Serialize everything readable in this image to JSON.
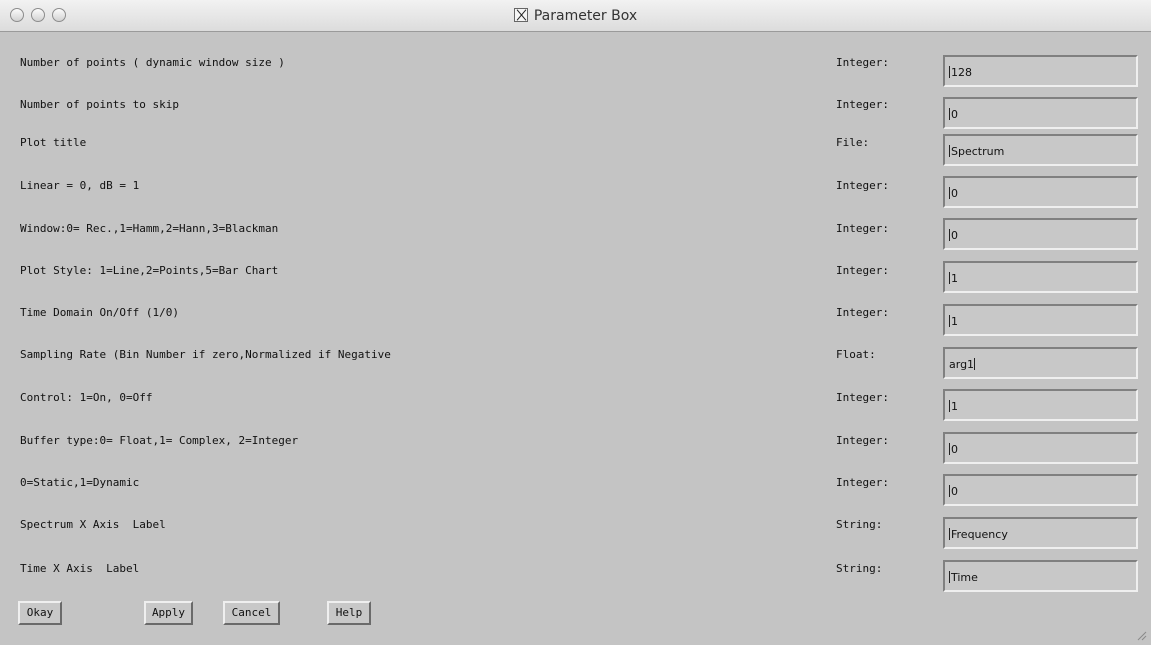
{
  "window": {
    "title": "Parameter Box"
  },
  "params": [
    {
      "label": "Number of points ( dynamic window size )",
      "type": "Integer:",
      "value": "128"
    },
    {
      "label": "Number of points to skip",
      "type": "Integer:",
      "value": "0"
    },
    {
      "label": "Plot title",
      "type": "File:",
      "value": "Spectrum"
    },
    {
      "label": "Linear = 0, dB = 1",
      "type": "Integer:",
      "value": "0"
    },
    {
      "label": "Window:0= Rec.,1=Hamm,2=Hann,3=Blackman",
      "type": "Integer:",
      "value": "0"
    },
    {
      "label": "Plot Style: 1=Line,2=Points,5=Bar Chart",
      "type": "Integer:",
      "value": "1"
    },
    {
      "label": "Time Domain On/Off (1/0)",
      "type": "Integer:",
      "value": "1"
    },
    {
      "label": "Sampling Rate (Bin Number if zero,Normalized if Negative",
      "type": "Float:",
      "value": "arg1"
    },
    {
      "label": "Control: 1=On, 0=Off",
      "type": "Integer:",
      "value": "1"
    },
    {
      "label": "Buffer type:0= Float,1= Complex, 2=Integer",
      "type": "Integer:",
      "value": "0"
    },
    {
      "label": "0=Static,1=Dynamic",
      "type": "Integer:",
      "value": "0"
    },
    {
      "label": "Spectrum X Axis  Label",
      "type": "String:",
      "value": "Frequency"
    },
    {
      "label": "Time X Axis  Label",
      "type": "String:",
      "value": "Time"
    }
  ],
  "buttons": {
    "okay": "Okay",
    "apply": "Apply",
    "cancel": "Cancel",
    "help": "Help"
  }
}
